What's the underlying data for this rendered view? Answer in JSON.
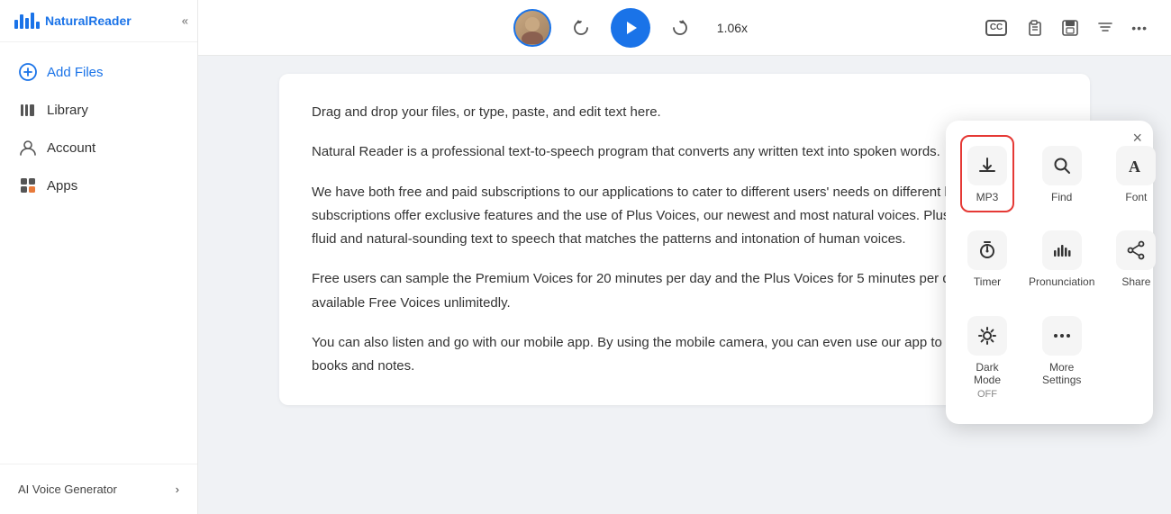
{
  "sidebar": {
    "logo_text_plain": "aturalReader",
    "logo_text_blue": "N",
    "collapse_label": "«",
    "nav_items": [
      {
        "id": "add-files",
        "label": "Add Files",
        "icon": "plus-circle"
      },
      {
        "id": "library",
        "label": "Library",
        "icon": "library"
      },
      {
        "id": "account",
        "label": "Account",
        "icon": "account"
      },
      {
        "id": "apps",
        "label": "Apps",
        "icon": "apps"
      }
    ],
    "ai_voice_label": "AI Voice Generator",
    "ai_voice_arrow": "›"
  },
  "toolbar": {
    "speed": "1.06x",
    "replay_icon": "↺",
    "forward_icon": "↻",
    "play_icon": "▶",
    "cc_label": "CC",
    "clipboard_icon": "📋",
    "save_icon": "💾",
    "filter_icon": "▼",
    "more_icon": "•••"
  },
  "content": {
    "paragraphs": [
      "Drag and drop your files, or type, paste, and edit text here.",
      "Natural Reader is a professional text-to-speech program that converts any written text into spoken words.",
      "We have both free and paid subscriptions to our applications to cater to different users' needs on different budgets. Our Plus subscriptions offer exclusive features and the use of Plus Voices, our newest and most natural voices. Plus Voices enable fluid and natural-sounding text to speech that matches the patterns and intonation of human voices.",
      "Free users can sample the Premium Voices for 20 minutes per day and the Plus Voices for 5 minutes per day. Or use any available Free Voices unlimitedly.",
      "You can also listen and go with our mobile app. By using the mobile camera, you can even use our app to listen to physical books and notes."
    ]
  },
  "popup": {
    "close_label": "×",
    "items": [
      {
        "id": "mp3",
        "label": "MP3",
        "icon_type": "download",
        "active": true
      },
      {
        "id": "find",
        "label": "Find",
        "icon_type": "search"
      },
      {
        "id": "font",
        "label": "Font",
        "icon_type": "font"
      },
      {
        "id": "timer",
        "label": "Timer",
        "icon_type": "timer"
      },
      {
        "id": "pronunciation",
        "label": "Pronunciation",
        "icon_type": "pronunciation"
      },
      {
        "id": "share",
        "label": "Share",
        "icon_type": "share"
      },
      {
        "id": "darkmode",
        "label": "Dark Mode\nOFF",
        "label_line1": "Dark Mode",
        "label_line2": "OFF",
        "icon_type": "sun"
      },
      {
        "id": "moresettings",
        "label": "More\nSettings",
        "label_line1": "More",
        "label_line2": "Settings",
        "icon_type": "more"
      }
    ]
  }
}
